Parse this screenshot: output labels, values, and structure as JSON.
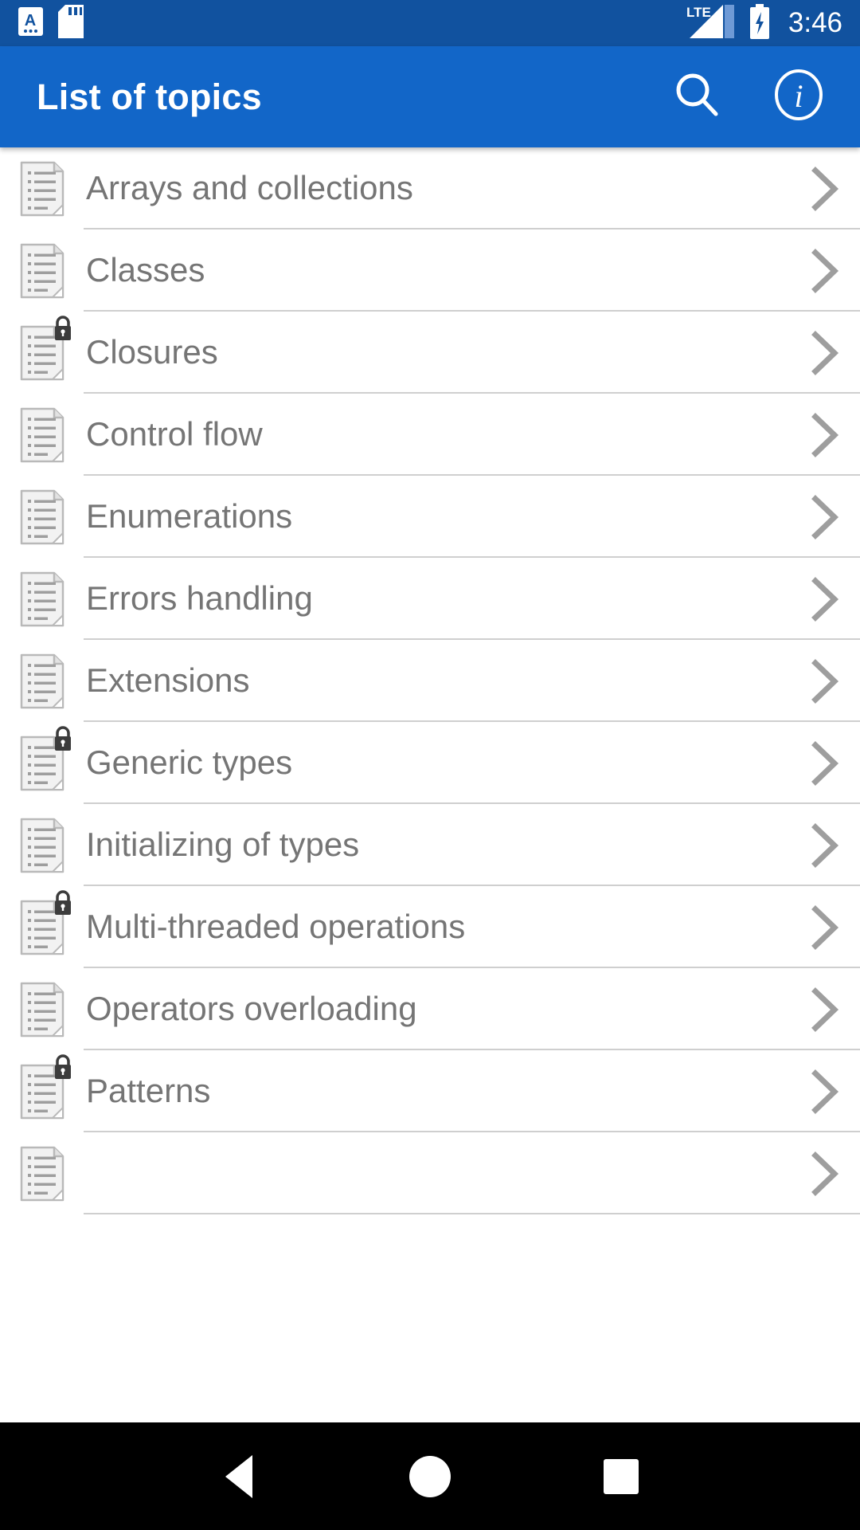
{
  "status_bar": {
    "background_color": "#11529f",
    "time": "3:46",
    "icons": [
      {
        "name": "input-method-a-icon",
        "label": "A"
      },
      {
        "name": "sd-card-icon",
        "label": "SD"
      },
      {
        "name": "lte-signal-icon",
        "label": "LTE"
      },
      {
        "name": "battery-charging-icon",
        "label": "Battery charging"
      }
    ]
  },
  "app_bar": {
    "background_color": "#1266c8",
    "title": "List of topics",
    "actions": [
      {
        "name": "search-button",
        "icon": "search-icon",
        "label": "Search"
      },
      {
        "name": "info-button",
        "icon": "info-circle-icon",
        "label": "Info"
      }
    ]
  },
  "list": {
    "text_color": "#757575",
    "divider_color": "#cfcfcf",
    "items": [
      {
        "label": "Arrays and collections",
        "locked": false
      },
      {
        "label": "Classes",
        "locked": false
      },
      {
        "label": "Closures",
        "locked": true
      },
      {
        "label": "Control flow",
        "locked": false
      },
      {
        "label": "Enumerations",
        "locked": false
      },
      {
        "label": "Errors handling",
        "locked": false
      },
      {
        "label": "Extensions",
        "locked": false
      },
      {
        "label": "Generic types",
        "locked": true
      },
      {
        "label": "Initializing of types",
        "locked": false
      },
      {
        "label": "Multi-threaded operations",
        "locked": true
      },
      {
        "label": "Operators overloading",
        "locked": false
      },
      {
        "label": "Patterns",
        "locked": true
      },
      {
        "label": "",
        "locked": false
      }
    ]
  },
  "nav_bar": {
    "background_color": "#000000",
    "buttons": [
      {
        "name": "nav-back-button",
        "label": "Back"
      },
      {
        "name": "nav-home-button",
        "label": "Home"
      },
      {
        "name": "nav-recents-button",
        "label": "Recents"
      }
    ]
  }
}
